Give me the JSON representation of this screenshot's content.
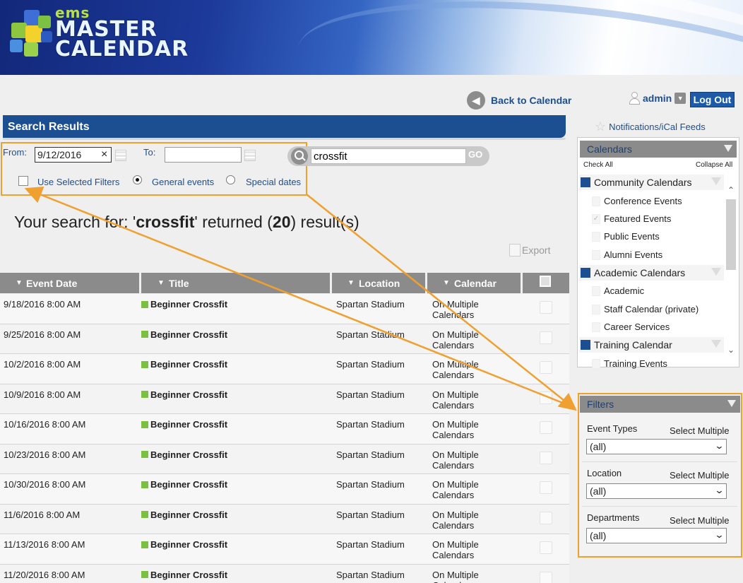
{
  "header": {
    "logo_ems": "ems",
    "logo_line1": "MASTER",
    "logo_line2": "CALENDAR"
  },
  "nav": {
    "back_label": "Back to Calendar",
    "username": "admin",
    "logout_label": "Log Out",
    "notifications_label": "Notifications/iCal Feeds"
  },
  "search": {
    "bar_title": "Search Results",
    "from_label": "From:",
    "from_value": "9/12/2016",
    "to_label": "To:",
    "to_value": "",
    "query": "crossfit",
    "go_label": "GO",
    "use_filters_label": "Use Selected Filters",
    "general_label": "General events",
    "special_label": "Special dates",
    "result_prefix": "Your search for: '",
    "result_term": "crossfit",
    "result_mid": "' returned (",
    "result_count": "20",
    "result_suffix": ") result(s)",
    "export_label": "Export"
  },
  "table": {
    "columns": [
      "Event Date",
      "Title",
      "Location",
      "Calendar"
    ],
    "rows": [
      {
        "date": "9/18/2016 8:00 AM",
        "title": "Beginner Crossfit",
        "location": "Spartan Stadium",
        "cal1": "On Multiple",
        "cal2": "Calendars"
      },
      {
        "date": "9/25/2016 8:00 AM",
        "title": "Beginner Crossfit",
        "location": "Spartan Stadium",
        "cal1": "On Multiple",
        "cal2": "Calendars"
      },
      {
        "date": "10/2/2016 8:00 AM",
        "title": "Beginner Crossfit",
        "location": "Spartan Stadium",
        "cal1": "On Multiple",
        "cal2": "Calendars"
      },
      {
        "date": "10/9/2016 8:00 AM",
        "title": "Beginner Crossfit",
        "location": "Spartan Stadium",
        "cal1": "On Multiple",
        "cal2": "Calendars"
      },
      {
        "date": "10/16/2016 8:00 AM",
        "title": "Beginner Crossfit",
        "location": "Spartan Stadium",
        "cal1": "On Multiple",
        "cal2": "Calendars"
      },
      {
        "date": "10/23/2016 8:00 AM",
        "title": "Beginner Crossfit",
        "location": "Spartan Stadium",
        "cal1": "On Multiple",
        "cal2": "Calendars"
      },
      {
        "date": "10/30/2016 8:00 AM",
        "title": "Beginner Crossfit",
        "location": "Spartan Stadium",
        "cal1": "On Multiple",
        "cal2": "Calendars"
      },
      {
        "date": "11/6/2016 8:00 AM",
        "title": "Beginner Crossfit",
        "location": "Spartan Stadium",
        "cal1": "On Multiple",
        "cal2": "Calendars"
      },
      {
        "date": "11/13/2016 8:00 AM",
        "title": "Beginner Crossfit",
        "location": "Spartan Stadium",
        "cal1": "On Multiple",
        "cal2": "Calendars"
      },
      {
        "date": "11/20/2016 8:00 AM",
        "title": "Beginner Crossfit",
        "location": "Spartan Stadium",
        "cal1": "On Multiple",
        "cal2": "Calendars"
      }
    ]
  },
  "calendars": {
    "title": "Calendars",
    "check_all": "Check All",
    "collapse_all": "Collapse All",
    "groups": [
      {
        "name": "Community Calendars",
        "items": [
          "Conference Events",
          "Featured Events",
          "Public Events",
          "Alumni Events"
        ]
      },
      {
        "name": "Academic Calendars",
        "items": [
          "Academic",
          "Staff Calendar (private)",
          "Career Services"
        ]
      },
      {
        "name": "Training Calendar",
        "items": [
          "Training Events"
        ]
      }
    ]
  },
  "filters": {
    "title": "Filters",
    "select_multiple": "Select Multiple",
    "event_types_label": "Event Types",
    "event_types_value": "(all)",
    "location_label": "Location",
    "location_value": "(all)",
    "departments_label": "Departments",
    "departments_value": "(all)"
  },
  "colors": {
    "brand_blue": "#1c4f92",
    "highlight_orange": "#f0a030",
    "event_green": "#7ac142",
    "header_gray": "#8b8b8b"
  }
}
